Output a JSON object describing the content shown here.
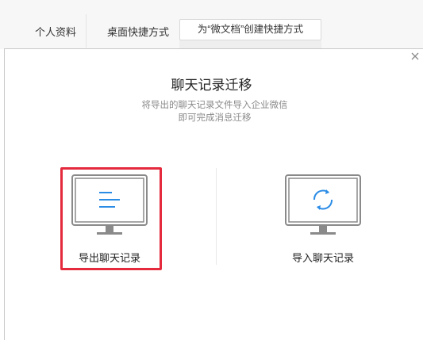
{
  "settings": {
    "profile_label": "个人资料",
    "shortcut_label": "桌面快捷方式",
    "create_shortcut_button": "为“微文档”创建快捷方式"
  },
  "dialog": {
    "title": "聊天记录迁移",
    "subtitle_line1": "将导出的聊天记录文件导入企业微信",
    "subtitle_line2": "即可完成消息迁移",
    "options": [
      {
        "label": "导出聊天记录",
        "icon": "monitor-list-icon",
        "highlighted": true
      },
      {
        "label": "导入聊天记录",
        "icon": "monitor-sync-icon",
        "highlighted": false
      }
    ],
    "colors": {
      "accent_blue": "#2b8ce6",
      "monitor_gray": "#8a8a8a",
      "highlight_red": "#e42a3c"
    }
  }
}
